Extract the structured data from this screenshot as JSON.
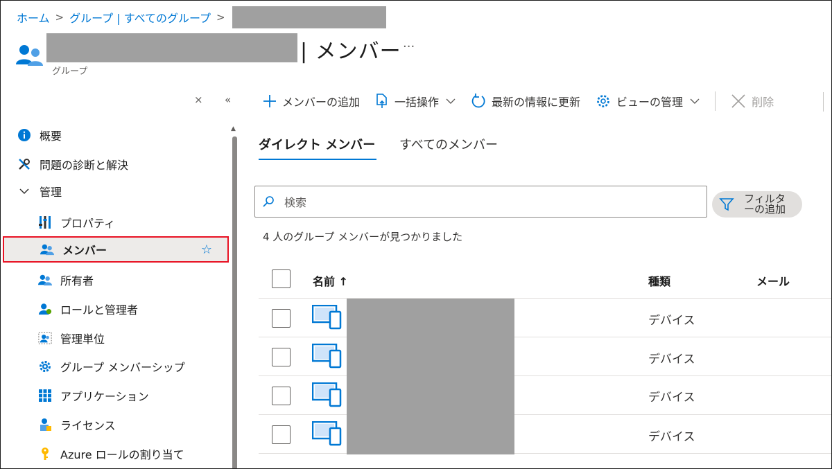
{
  "breadcrumb": {
    "home": "ホーム",
    "groups": "グループ | すべてのグループ",
    "separator": ">"
  },
  "header": {
    "title": "| メンバー",
    "more": "···",
    "subtitle": "グループ"
  },
  "sidebar": {
    "close": "×",
    "collapse": "«",
    "items": [
      {
        "label": "概要",
        "icon": "info-icon"
      },
      {
        "label": "問題の診断と解決",
        "icon": "wrench-icon"
      },
      {
        "label": "管理",
        "icon": "chevron-down-icon"
      },
      {
        "label": "プロパティ",
        "icon": "properties-icon"
      },
      {
        "label": "メンバー",
        "icon": "members-icon",
        "selected": true
      },
      {
        "label": "所有者",
        "icon": "owners-icon"
      },
      {
        "label": "ロールと管理者",
        "icon": "roles-icon"
      },
      {
        "label": "管理単位",
        "icon": "admin-unit-icon"
      },
      {
        "label": "グループ メンバーシップ",
        "icon": "gear-icon"
      },
      {
        "label": "アプリケーション",
        "icon": "apps-grid-icon"
      },
      {
        "label": "ライセンス",
        "icon": "license-icon"
      },
      {
        "label": "Azure ロールの割り当て",
        "icon": "key-icon"
      }
    ],
    "star": "☆"
  },
  "toolbar": {
    "add_member": "メンバーの追加",
    "bulk_ops": "一括操作",
    "refresh": "最新の情報に更新",
    "manage_view": "ビューの管理",
    "delete": "削除"
  },
  "tabs": {
    "direct": "ダイレクト メンバー",
    "all": "すべてのメンバー"
  },
  "search": {
    "placeholder": "検索"
  },
  "filter": {
    "label": "フィルターの追加"
  },
  "results": {
    "count_text": "4 人のグループ メンバーが見つかりました"
  },
  "table": {
    "columns": {
      "name": "名前 ↑",
      "type": "種類",
      "mail": "メール"
    },
    "rows": [
      {
        "type": "デバイス"
      },
      {
        "type": "デバイス"
      },
      {
        "type": "デバイス"
      },
      {
        "type": "デバイス"
      }
    ]
  },
  "colors": {
    "accent": "#0078d4",
    "selected_border": "#e81123",
    "selected_bg": "#edebe9",
    "redaction": "#a0a0a0"
  }
}
